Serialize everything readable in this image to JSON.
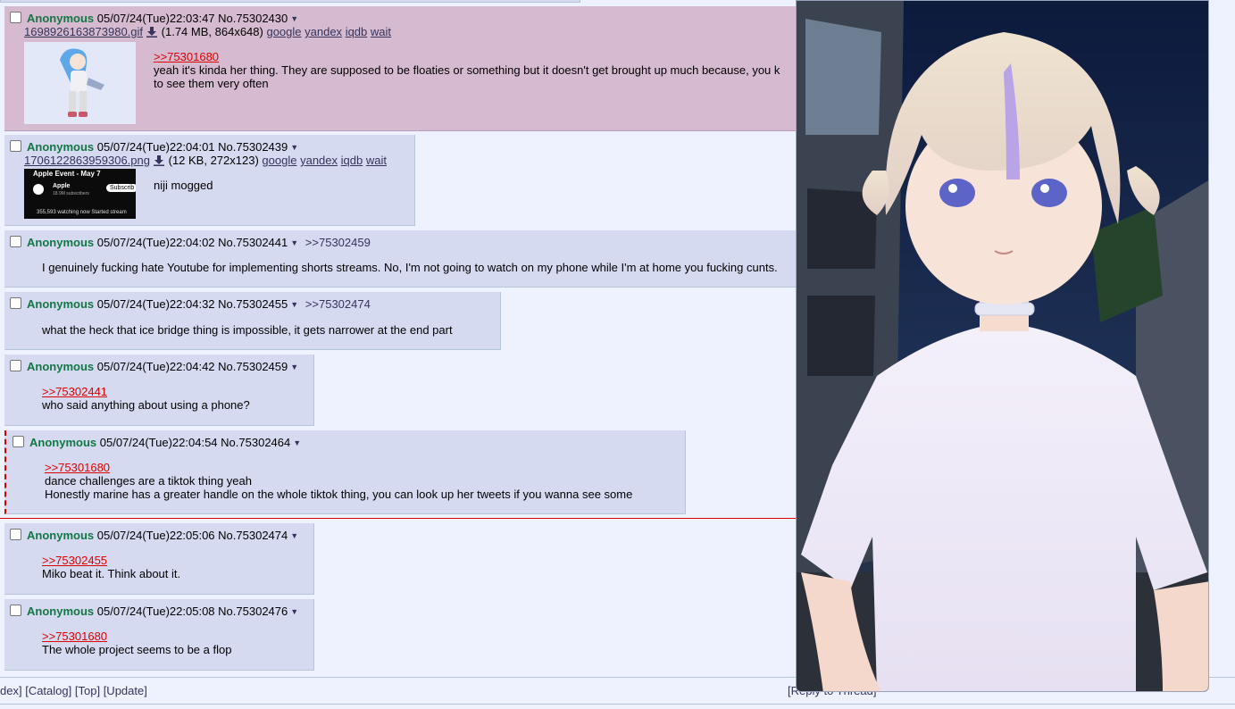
{
  "posts": [
    {
      "name": "Anonymous",
      "datetime": "05/07/24(Tue)22:03:47",
      "number": "No.75302430",
      "file": {
        "filename": "1698926163873980.gif",
        "info": "(1.74 MB, 864x648)"
      },
      "image_search": [
        "google",
        "yandex",
        "iqdb",
        "wait"
      ],
      "quotelink": ">>75301680",
      "text_lines": [
        "yeah it's kinda her thing. They are supposed to be floaties or something but it doesn't get brought up much because, you k",
        "to see them very often"
      ]
    },
    {
      "name": "Anonymous",
      "datetime": "05/07/24(Tue)22:04:01",
      "number": "No.75302439",
      "file": {
        "filename": "1706122863959306.png",
        "info": "(12 KB, 272x123)"
      },
      "image_search": [
        "google",
        "yandex",
        "iqdb",
        "wait"
      ],
      "thumb": {
        "title": "Apple Event - May 7",
        "channel": "Apple",
        "subs": "18.9M subscribers",
        "button": "Subscrib",
        "stats": "355,593 watching now  Started stream"
      },
      "text_lines": [
        "niji mogged"
      ]
    },
    {
      "name": "Anonymous",
      "datetime": "05/07/24(Tue)22:04:02",
      "number": "No.75302441",
      "backlink": ">>75302459",
      "text_lines": [
        "I genuinely fucking hate Youtube for implementing shorts streams. No, I'm not going to watch on my phone while I'm at home you fucking cunts."
      ]
    },
    {
      "name": "Anonymous",
      "datetime": "05/07/24(Tue)22:04:32",
      "number": "No.75302455",
      "backlink": ">>75302474",
      "text_lines": [
        "what the heck that ice bridge thing is impossible, it gets narrower at the end part"
      ]
    },
    {
      "name": "Anonymous",
      "datetime": "05/07/24(Tue)22:04:42",
      "number": "No.75302459",
      "quotelink": ">>75302441",
      "text_lines": [
        "who said anything about using a phone?"
      ]
    },
    {
      "name": "Anonymous",
      "datetime": "05/07/24(Tue)22:04:54",
      "number": "No.75302464",
      "quotelink": ">>75301680",
      "text_lines": [
        "dance challenges are a tiktok thing yeah",
        "Honestly marine has a greater handle on the whole tiktok thing, you can look up her tweets if you wanna see some"
      ]
    },
    {
      "name": "Anonymous",
      "datetime": "05/07/24(Tue)22:05:06",
      "number": "No.75302474",
      "quotelink": ">>75302455",
      "text_lines": [
        "Miko beat it. Think about it."
      ]
    },
    {
      "name": "Anonymous",
      "datetime": "05/07/24(Tue)22:05:08",
      "number": "No.75302476",
      "quotelink": ">>75301680",
      "text_lines": [
        "The whole project seems to be a flop"
      ]
    }
  ],
  "bottom_nav": {
    "index": "dex]",
    "catalog": "[Catalog]",
    "top": "[Top]",
    "update": "[Update]",
    "reply": "[Reply to Thread]"
  },
  "colors": {
    "name_green": "#117743",
    "quotelink_red": "#dd0000",
    "post_bg": "#d6daf0",
    "highlight_bg": "#d6bad0",
    "page_bg": "#eef2ff"
  }
}
